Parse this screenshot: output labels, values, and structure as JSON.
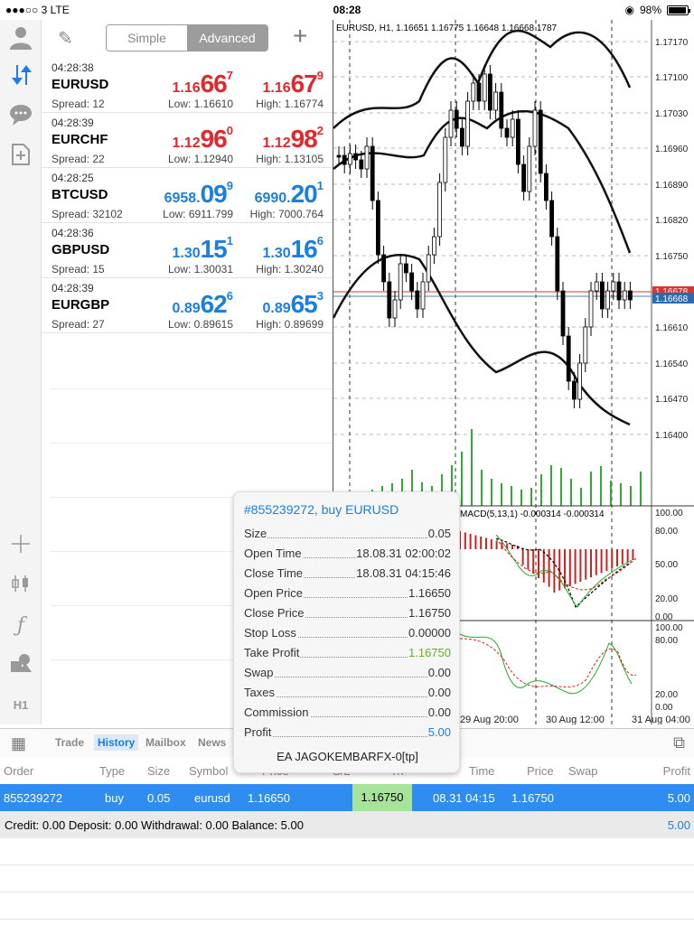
{
  "status_bar": {
    "carrier": "●●●○○ 3  LTE",
    "time": "08:28",
    "battery": "98%"
  },
  "colors": {
    "bid_ask_down": "#e0282d",
    "bid_ask_up": "#1a7fe0",
    "selected_row": "#2f8cf0",
    "tp_cell": "#a8e39c"
  },
  "rail": {
    "icons": [
      "account-icon",
      "quotes-icon",
      "chat-icon",
      "new-document-icon",
      "crosshair-icon",
      "candlestick-icon",
      "indicator-icon",
      "objects-icon",
      "timeframe-icon"
    ],
    "timeframe": "H1"
  },
  "quotes_toolbar": {
    "simple": "Simple",
    "advanced": "Advanced"
  },
  "quotes": [
    {
      "time": "04:28:38",
      "symbol": "EURUSD",
      "spread": "Spread: 12",
      "low": "Low: 1.16610",
      "high": "High: 1.16774",
      "bid": {
        "small": "1.16",
        "big": "66",
        "sup": "7"
      },
      "ask": {
        "small": "1.16",
        "big": "67",
        "sup": "9"
      },
      "color": "red"
    },
    {
      "time": "04:28:39",
      "symbol": "EURCHF",
      "spread": "Spread: 22",
      "low": "Low: 1.12940",
      "high": "High: 1.13105",
      "bid": {
        "small": "1.12",
        "big": "96",
        "sup": "0"
      },
      "ask": {
        "small": "1.12",
        "big": "98",
        "sup": "2"
      },
      "color": "red"
    },
    {
      "time": "04:28:25",
      "symbol": "BTCUSD",
      "spread": "Spread: 32102",
      "low": "Low: 6911.799",
      "high": "High: 7000.764",
      "bid": {
        "small": "6958.",
        "big": "09",
        "sup": "9"
      },
      "ask": {
        "small": "6990.",
        "big": "20",
        "sup": "1"
      },
      "color": "blue"
    },
    {
      "time": "04:28:36",
      "symbol": "GBPUSD",
      "spread": "Spread: 15",
      "low": "Low: 1.30031",
      "high": "High: 1.30240",
      "bid": {
        "small": "1.30",
        "big": "15",
        "sup": "1"
      },
      "ask": {
        "small": "1.30",
        "big": "16",
        "sup": "6"
      },
      "color": "blue"
    },
    {
      "time": "04:28:39",
      "symbol": "EURGBP",
      "spread": "Spread: 27",
      "low": "Low: 0.89615",
      "high": "High: 0.89699",
      "bid": {
        "small": "0.89",
        "big": "62",
        "sup": "6"
      },
      "ask": {
        "small": "0.89",
        "big": "65",
        "sup": "3"
      },
      "color": "blue"
    }
  ],
  "chart": {
    "header": "EURUSD, H1, 1.16651 1.16775 1.16648 1.16668 1787",
    "price_levels": [
      "1.17170",
      "1.17100",
      "1.17030",
      "1.16960",
      "1.16890",
      "1.16820",
      "1.16750",
      "1.16678",
      "1.16668",
      "1.16610",
      "1.16540",
      "1.16470",
      "1.16400"
    ],
    "macd_label": "MACD(5,13,1) -0.000314 -0.000314",
    "osc1_levels": [
      "100.00",
      "80.00",
      "50.00",
      "20.00",
      "0.00"
    ],
    "osc2_levels": [
      "100.00",
      "80.00",
      "20.00",
      "0.00"
    ],
    "time_labels": [
      "29 Aug 20:00",
      "30 Aug 12:00",
      "31 Aug 04:00"
    ]
  },
  "tabs": {
    "trade": "Trade",
    "history": "History",
    "mailbox": "Mailbox",
    "news": "News"
  },
  "history_table": {
    "headers": [
      "Order",
      "Type",
      "Size",
      "Symbol",
      "Price",
      "S/L",
      "T/P",
      "Time",
      "Price",
      "Swap",
      "Profit"
    ],
    "row": {
      "order": "855239272",
      "type": "buy",
      "size": "0.05",
      "symbol": "eurusd",
      "price": "1.16650",
      "tp": "1.16750",
      "time": "08.31 04:15",
      "close_price": "1.16750",
      "profit": "5.00"
    },
    "balance_line": "Credit: 0.00 Deposit: 0.00 Withdrawal: 0.00 Balance: 5.00",
    "balance_total": "5.00"
  },
  "popup": {
    "title": "#855239272, buy EURUSD",
    "rows": [
      {
        "k": "Size",
        "v": "0.05"
      },
      {
        "k": "Open Time",
        "v": "18.08.31 02:00:02"
      },
      {
        "k": "Close Time",
        "v": "18.08.31 04:15:46"
      },
      {
        "k": "Open Price",
        "v": "1.16650"
      },
      {
        "k": "Close Price",
        "v": "1.16750"
      },
      {
        "k": "Stop Loss",
        "v": "0.00000"
      },
      {
        "k": "Take Profit",
        "v": "1.16750"
      },
      {
        "k": "Swap",
        "v": "0.00"
      },
      {
        "k": "Taxes",
        "v": "0.00"
      },
      {
        "k": "Commission",
        "v": "0.00"
      },
      {
        "k": "Profit",
        "v": "5.00"
      }
    ],
    "comment": "EA JAGOKEMBARFX-0[tp]"
  }
}
